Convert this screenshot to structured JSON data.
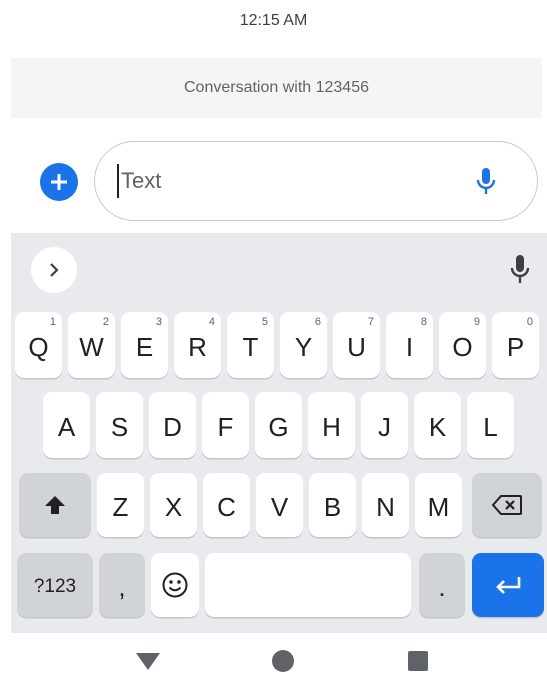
{
  "status_bar": {
    "time": "12:15 AM"
  },
  "conversation": {
    "title": "Conversation with 123456"
  },
  "compose": {
    "add_icon": "plus-icon",
    "placeholder": "Text",
    "mic_icon": "microphone-icon"
  },
  "keyboard": {
    "suggestion_strip": {
      "expand_icon": "chevron-right-icon",
      "voice_icon": "microphone-icon"
    },
    "row1": [
      {
        "label": "Q",
        "hint": "1"
      },
      {
        "label": "W",
        "hint": "2"
      },
      {
        "label": "E",
        "hint": "3"
      },
      {
        "label": "R",
        "hint": "4"
      },
      {
        "label": "T",
        "hint": "5"
      },
      {
        "label": "Y",
        "hint": "6"
      },
      {
        "label": "U",
        "hint": "7"
      },
      {
        "label": "I",
        "hint": "8"
      },
      {
        "label": "O",
        "hint": "9"
      },
      {
        "label": "P",
        "hint": "0"
      }
    ],
    "row2": [
      "A",
      "S",
      "D",
      "F",
      "G",
      "H",
      "J",
      "K",
      "L"
    ],
    "row3": [
      "Z",
      "X",
      "C",
      "V",
      "B",
      "N",
      "M"
    ],
    "shift_icon": "shift-arrow-icon",
    "backspace_icon": "backspace-icon",
    "symbols_label": "?123",
    "comma_label": ",",
    "emoji_icon": "emoji-icon",
    "period_label": ".",
    "enter_icon": "enter-arrow-icon"
  },
  "nav_bar": {
    "back_icon": "back-triangle-icon",
    "home_icon": "home-circle-icon",
    "recents_icon": "recents-square-icon"
  },
  "colors": {
    "accent": "#1a73e8",
    "keyboard_bg": "#e8eaed",
    "key_bg": "#ffffff",
    "special_key_bg": "#d0d3d8"
  }
}
